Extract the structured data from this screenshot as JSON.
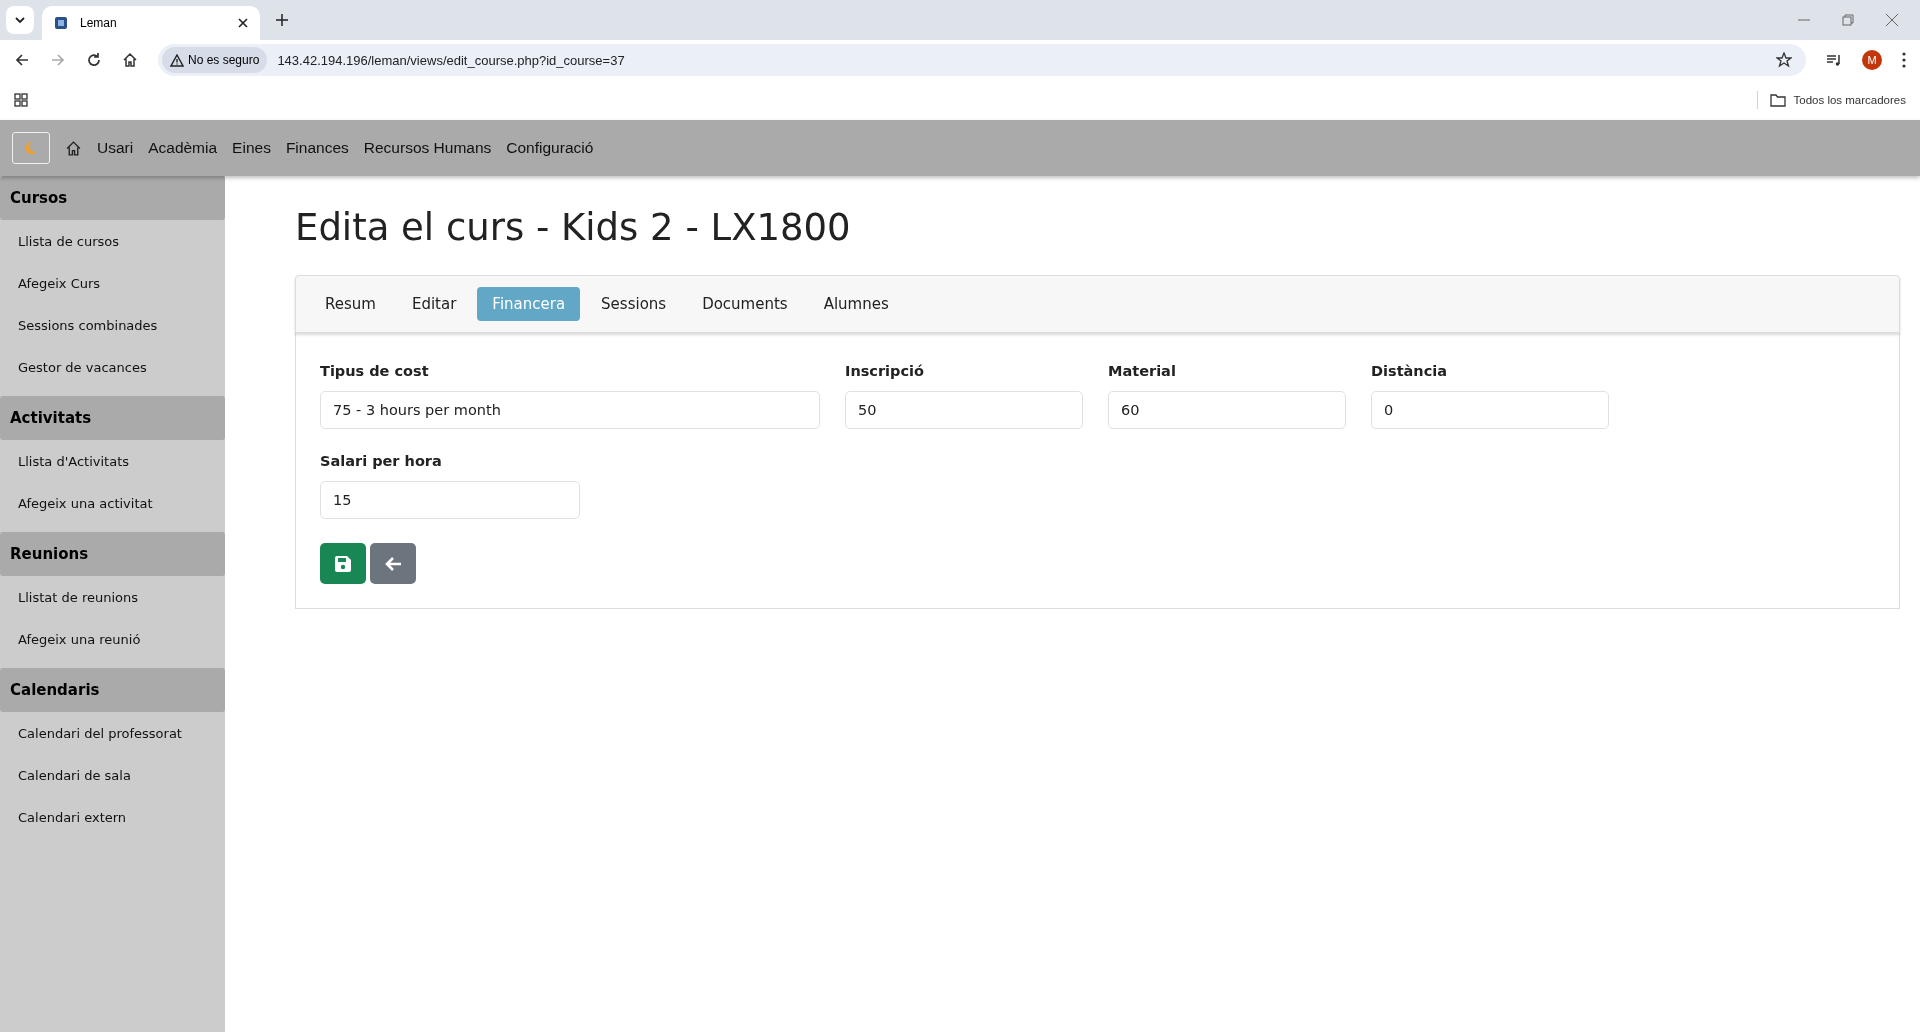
{
  "browser": {
    "tab_title": "Leman",
    "security": "No es seguro",
    "url": "143.42.194.196/leman/views/edit_course.php?id_course=37",
    "profile_initial": "M",
    "bookmarks_label": "Todos los marcadores"
  },
  "navbar": {
    "items": [
      "Usari",
      "Acadèmia",
      "Eines",
      "Finances",
      "Recursos Humans",
      "Configuració"
    ]
  },
  "sidebar": {
    "sections": [
      {
        "title": "Cursos",
        "items": [
          "Llista de cursos",
          "Afegeix Curs",
          "Sessions combinades",
          "Gestor de vacances"
        ]
      },
      {
        "title": "Activitats",
        "items": [
          "Llista d'Activitats",
          "Afegeix una activitat"
        ]
      },
      {
        "title": "Reunions",
        "items": [
          "Llistat de reunions",
          "Afegeix una reunió"
        ]
      },
      {
        "title": "Calendaris",
        "items": [
          "Calendari del professorat",
          "Calendari de sala",
          "Calendari extern"
        ]
      }
    ]
  },
  "page_title": "Edita el curs - Kids 2 - LX1800",
  "tabs": [
    {
      "label": "Resum",
      "selected": false
    },
    {
      "label": "Editar",
      "selected": false
    },
    {
      "label": "Financera",
      "selected": true
    },
    {
      "label": "Sessions",
      "selected": false
    },
    {
      "label": "Documents",
      "selected": false
    },
    {
      "label": "Alumnes",
      "selected": false
    }
  ],
  "form_rows": [
    [
      {
        "label": "Tipus de cost",
        "value": "75 - 3 hours per month",
        "kind": "wide"
      },
      {
        "label": "Inscripció",
        "value": "50",
        "kind": "narrow"
      },
      {
        "label": "Material",
        "value": "60",
        "kind": "narrow"
      },
      {
        "label": "Distància",
        "value": "0",
        "kind": "narrow"
      }
    ],
    [
      {
        "label": "Salari per hora",
        "value": "15",
        "kind": "medium"
      }
    ]
  ],
  "buttons": [
    {
      "kind": "save"
    },
    {
      "kind": "back"
    }
  ]
}
